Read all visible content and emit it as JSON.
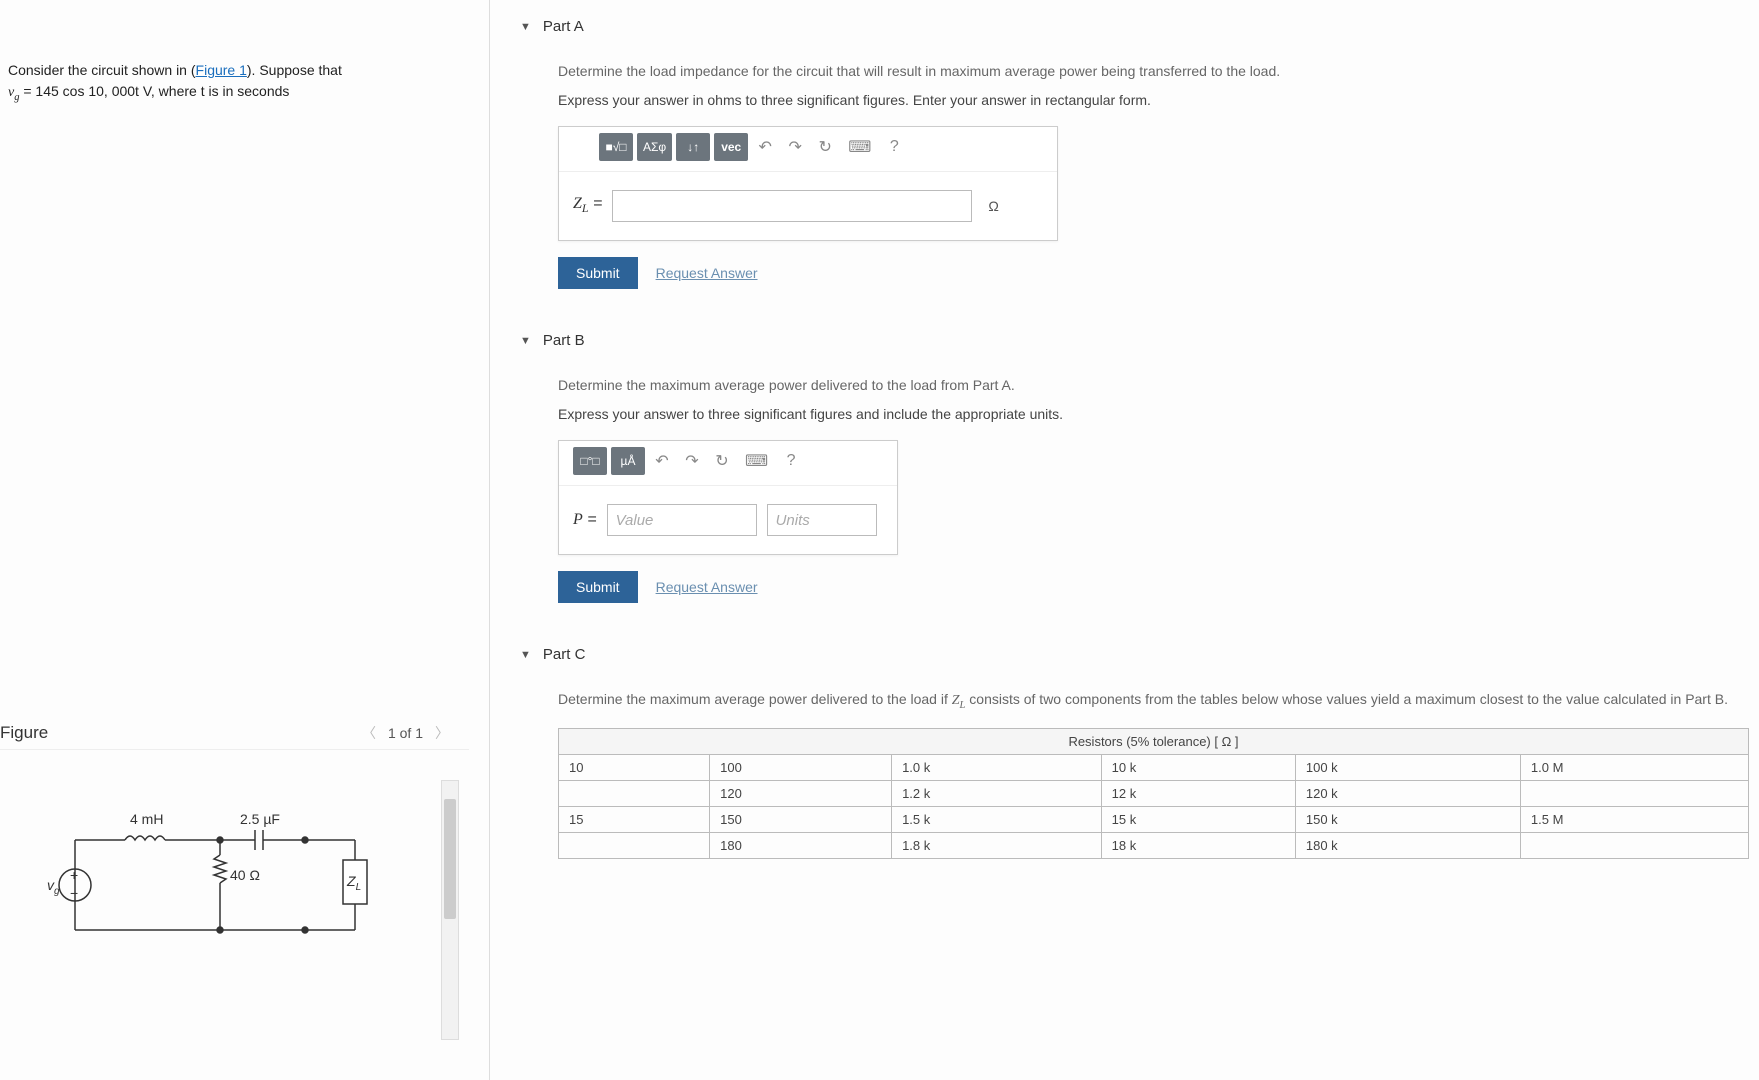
{
  "intro": {
    "line1a": "Consider the circuit shown in (",
    "figlink": "Figure 1",
    "line1b": "). Suppose that",
    "eq_lhs": "v",
    "eq_sub": "g",
    "eq_rhs": " = 145 cos 10, 000t V, where t is in seconds"
  },
  "figure": {
    "title": "Figure",
    "page": "1 of 1",
    "labels": {
      "L": "4 mH",
      "C": "2.5 µF",
      "R": "40 Ω",
      "vg": "v",
      "vg_sub": "g",
      "ZL": "Z",
      "ZL_sub": "L"
    }
  },
  "partA": {
    "title": "Part A",
    "q": "Determine the load impedance for the circuit that will result in maximum average power being transferred to the load.",
    "sub": "Express your answer in ohms to three significant figures. Enter your answer in rectangular form.",
    "var": "Z",
    "var_sub": "L",
    "suffix": "Ω",
    "toolbar": {
      "tpl": "■√□",
      "greek": "ΑΣφ",
      "down": "↓↑",
      "vec": "vec",
      "undo": "↶",
      "redo": "↷",
      "reset": "↻",
      "kbd": "⌨",
      "help": "?"
    },
    "submit": "Submit",
    "request": "Request Answer"
  },
  "partB": {
    "title": "Part B",
    "q": "Determine the maximum average power delivered to the load from Part A.",
    "sub": "Express your answer to three significant figures and include the appropriate units.",
    "var": "P",
    "value_ph": "Value",
    "units_ph": "Units",
    "toolbar": {
      "units": "□°□",
      "mu": "µÅ",
      "undo": "↶",
      "redo": "↷",
      "reset": "↻",
      "kbd": "⌨",
      "help": "?"
    },
    "submit": "Submit",
    "request": "Request Answer"
  },
  "partC": {
    "title": "Part C",
    "q1": "Determine the maximum average power delivered to the load if ",
    "zvar": "Z",
    "zvar_sub": "L",
    "q2": " consists of two components from the tables below whose values yield a maximum closest to the value calculated in Part B.",
    "table_header": "Resistors (5% tolerance) [ Ω ]"
  },
  "chart_data": {
    "type": "table",
    "title": "Resistors (5% tolerance) [ Ω ]",
    "columns": [
      "",
      "",
      "",
      "",
      "",
      ""
    ],
    "rows": [
      [
        "10",
        "100",
        "1.0 k",
        "10 k",
        "100 k",
        "1.0 M"
      ],
      [
        "",
        "120",
        "1.2 k",
        "12 k",
        "120 k",
        ""
      ],
      [
        "15",
        "150",
        "1.5 k",
        "15 k",
        "150 k",
        "1.5 M"
      ],
      [
        "",
        "180",
        "1.8 k",
        "18 k",
        "180 k",
        ""
      ]
    ]
  }
}
